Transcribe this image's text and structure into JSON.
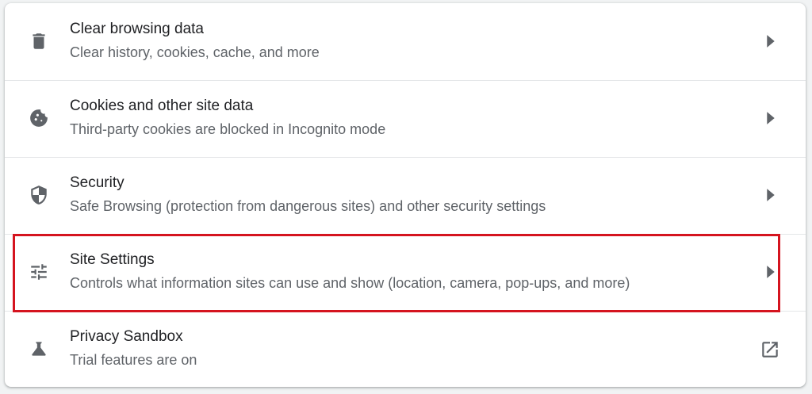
{
  "privacy_section": {
    "items": [
      {
        "title": "Clear browsing data",
        "subtitle": "Clear history, cookies, cache, and more",
        "icon": "trash-icon",
        "trailing": "chevron-right-icon"
      },
      {
        "title": "Cookies and other site data",
        "subtitle": "Third-party cookies are blocked in Incognito mode",
        "icon": "cookie-icon",
        "trailing": "chevron-right-icon"
      },
      {
        "title": "Security",
        "subtitle": "Safe Browsing (protection from dangerous sites) and other security settings",
        "icon": "shield-icon",
        "trailing": "chevron-right-icon"
      },
      {
        "title": "Site Settings",
        "subtitle": "Controls what information sites can use and show (location, camera, pop-ups, and more)",
        "icon": "tune-sliders-icon",
        "trailing": "chevron-right-icon",
        "highlighted": true
      },
      {
        "title": "Privacy Sandbox",
        "subtitle": "Trial features are on",
        "icon": "flask-icon",
        "trailing": "open-in-new-icon"
      }
    ]
  },
  "colors": {
    "highlight_border": "#d5141f",
    "title_text": "#202124",
    "subtitle_text": "#5f6368",
    "icon": "#5f6368"
  }
}
